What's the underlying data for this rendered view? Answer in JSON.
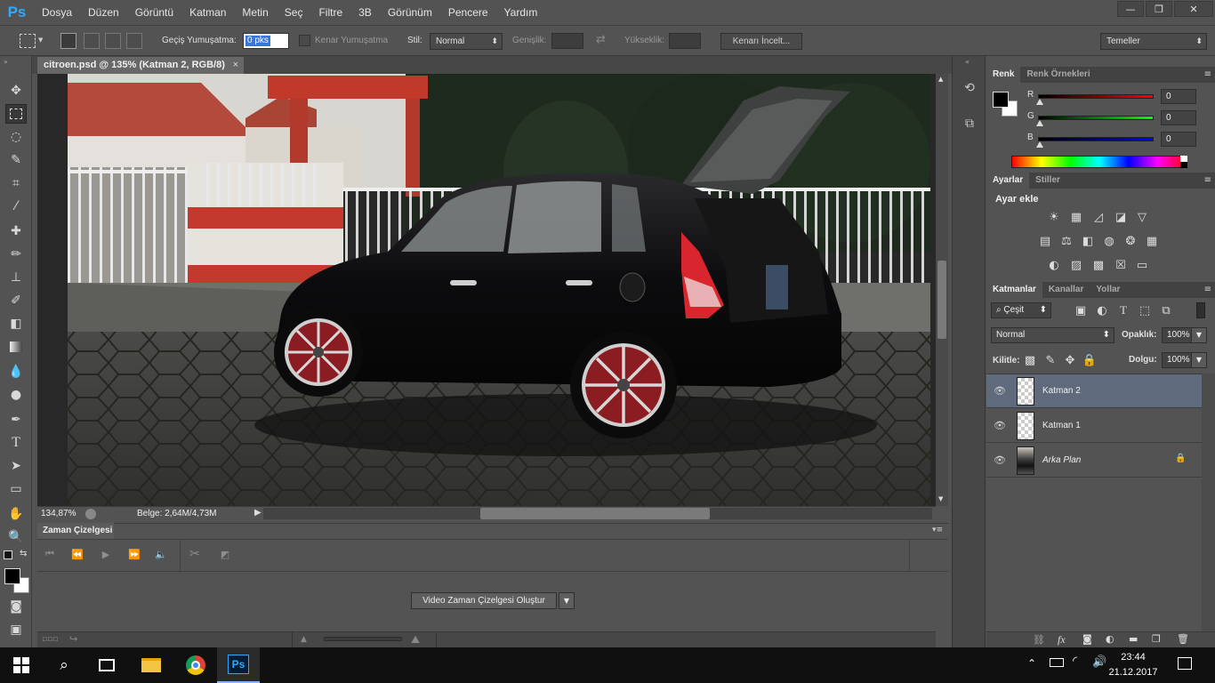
{
  "app": {
    "logo": "Ps",
    "menu": [
      "Dosya",
      "Düzen",
      "Görüntü",
      "Katman",
      "Metin",
      "Seç",
      "Filtre",
      "3B",
      "Görünüm",
      "Pencere",
      "Yardım"
    ],
    "window_controls": [
      "minimize-icon",
      "restore-icon",
      "close-icon"
    ]
  },
  "options": {
    "feather_label": "Geçiş Yumuşatma:",
    "feather_value": "0 pks",
    "antialias_label": "Kenar Yumuşatma",
    "style_label": "Stil:",
    "style_value": "Normal",
    "width_label": "Genişlik:",
    "height_label": "Yükseklik:",
    "refine_button": "Kenarı İncelt...",
    "workspace": "Temeller"
  },
  "tools": [
    "move-icon",
    "marquee-icon",
    "lasso-icon",
    "quick-select-icon",
    "crop-icon",
    "eyedropper-icon",
    "healing-icon",
    "brush-icon",
    "stamp-icon",
    "history-brush-icon",
    "eraser-icon",
    "gradient-icon",
    "blur-icon",
    "dodge-icon",
    "pen-icon",
    "type-icon",
    "path-select-icon",
    "shape-icon",
    "hand-icon",
    "zoom-icon"
  ],
  "document": {
    "tab_title": "citroen.psd @ 135% (Katman 2, RGB/8)",
    "tab_close": "×",
    "zoom": "134,87%",
    "doc_size": "Belge: 2,64M/4,73M"
  },
  "timeline": {
    "tab": "Zaman Çizelgesi",
    "create_button": "Video Zaman Çizelgesi Oluştur",
    "dropdown_glyph": "▼"
  },
  "color_panel": {
    "tabs": [
      "Renk",
      "Renk Örnekleri"
    ],
    "channels": [
      {
        "label": "R",
        "value": "0",
        "color": "#ff0000"
      },
      {
        "label": "G",
        "value": "0",
        "color": "#00ff00"
      },
      {
        "label": "B",
        "value": "0",
        "color": "#0000ff"
      }
    ],
    "foreground": "#000000",
    "background": "#ffffff"
  },
  "adjustments_panel": {
    "tabs": [
      "Ayarlar",
      "Stiller"
    ],
    "heading": "Ayar ekle"
  },
  "layers_panel": {
    "tabs": [
      "Katmanlar",
      "Kanallar",
      "Yollar"
    ],
    "filter_kind": "Çeşit",
    "blend_mode": "Normal",
    "opacity_label": "Opaklık:",
    "opacity_value": "100%",
    "lock_label": "Kilitle:",
    "fill_label": "Dolgu:",
    "fill_value": "100%",
    "layers": [
      {
        "name": "Katman 2",
        "selected": true,
        "italic": false
      },
      {
        "name": "Katman 1",
        "selected": false,
        "italic": false
      },
      {
        "name": "Arka Plan",
        "selected": false,
        "italic": true
      }
    ]
  },
  "taskbar": {
    "time": "23:44",
    "date": "21.12.2017",
    "ps_label": "Ps"
  }
}
